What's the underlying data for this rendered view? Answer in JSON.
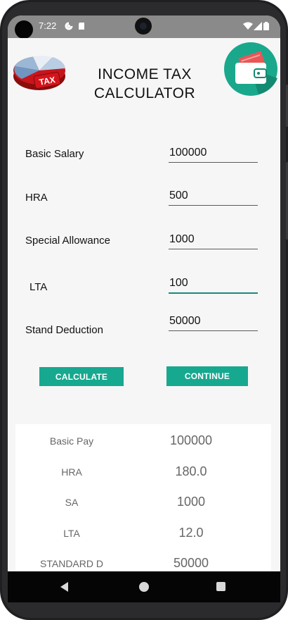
{
  "status_bar": {
    "time": "7:22"
  },
  "header": {
    "title_line1": "INCOME TAX",
    "title_line2": "CALCULATOR",
    "logo_text": "TAX"
  },
  "form": {
    "fields": [
      {
        "label": "Basic Salary",
        "value": "100000"
      },
      {
        "label": "HRA",
        "value": "500"
      },
      {
        "label": "Special Allowance",
        "value": "1000"
      },
      {
        "label": "LTA",
        "value": "100"
      },
      {
        "label": "Stand Deduction",
        "value": "50000"
      }
    ],
    "calculate_label": "CALCULATE",
    "continue_label": "CONTINUE"
  },
  "results": [
    {
      "label": "Basic Pay",
      "value": "100000"
    },
    {
      "label": "HRA",
      "value": "180.0"
    },
    {
      "label": "SA",
      "value": "1000"
    },
    {
      "label": "LTA",
      "value": "12.0"
    },
    {
      "label": "STANDARD D",
      "value": "50000"
    }
  ],
  "colors": {
    "accent": "#17a890",
    "focus_underline": "#17897e",
    "wallet_bg": "#1aa88d"
  },
  "icons": {
    "tax_logo": "tax-pie-chart-icon",
    "wallet_logo": "wallet-icon",
    "nav_back": "back-triangle-icon",
    "nav_home": "home-circle-icon",
    "nav_recent": "recents-square-icon"
  }
}
